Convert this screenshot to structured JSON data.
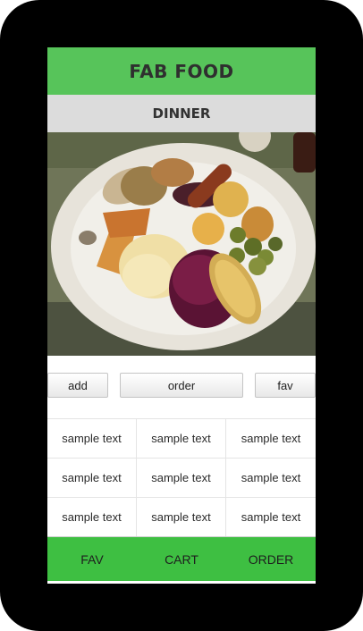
{
  "app": {
    "title": "FAB FOOD"
  },
  "section": {
    "title": "DINNER"
  },
  "actions": {
    "add_label": "add",
    "order_label": "order",
    "fav_label": "fav"
  },
  "table": {
    "rows": [
      [
        "sample text",
        "sample text",
        "sample text"
      ],
      [
        "sample text",
        "sample text",
        "sample text"
      ],
      [
        "sample text",
        "sample text",
        "sample text"
      ]
    ]
  },
  "bottom_nav": {
    "items": [
      "FAV",
      "CART",
      "ORDER"
    ]
  },
  "colors": {
    "header_green": "#57c45a",
    "nav_green": "#3ebf42",
    "section_gray": "#dcdcdc",
    "device_black": "#000000"
  },
  "image": {
    "icon": "roast-dinner-plate-image"
  }
}
